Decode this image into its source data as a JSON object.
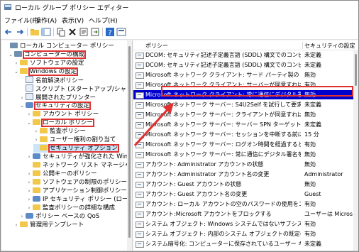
{
  "window": {
    "title": "ローカル グループ ポリシー エディター"
  },
  "menu": [
    "ファイル(F)",
    "操作(A)",
    "表示(V)",
    "ヘルプ(H)"
  ],
  "toolbar": [
    "back-icon",
    "forward-icon",
    "folder-up-icon",
    "console-tree-icon",
    "copy-icon",
    "delete-icon",
    "properties-icon",
    "export-icon",
    "help-icon",
    "view-icon"
  ],
  "tree": {
    "items": [
      {
        "label": "ローカル コンピューター ポリシー",
        "icon": "computer-icon",
        "expander": ""
      },
      {
        "label": "コンピューターの構成",
        "icon": "computer-icon",
        "expander": "⌄"
      },
      {
        "label": "ソフトウェアの設定",
        "icon": "folder-icon",
        "expander": "›"
      },
      {
        "label": "Windows の設定",
        "icon": "folder-icon",
        "expander": "⌄"
      },
      {
        "label": "名前解決ポリシー",
        "icon": "document-icon",
        "expander": ""
      },
      {
        "label": "スクリプト (スタートアップ/シャットダウン)",
        "icon": "document-icon",
        "expander": ""
      },
      {
        "label": "展開されたプリンター",
        "icon": "printer-icon",
        "expander": "›"
      },
      {
        "label": "セキュリティの設定",
        "icon": "shield-icon",
        "expander": "⌄"
      },
      {
        "label": "アカウント ポリシー",
        "icon": "folder-icon",
        "expander": "›"
      },
      {
        "label": "ローカル ポリシー",
        "icon": "folder-icon",
        "expander": "⌄"
      },
      {
        "label": "監査ポリシー",
        "icon": "folder-icon",
        "expander": "›"
      },
      {
        "label": "ユーザー権利の割り当て",
        "icon": "folder-icon",
        "expander": "›"
      },
      {
        "label": "セキュリティ オプション",
        "icon": "folder-icon",
        "expander": ""
      },
      {
        "label": "セキュリティが強化された Windows",
        "icon": "shield-icon",
        "expander": "›"
      },
      {
        "label": "ネットワーク リスト マネージャー ポリ",
        "icon": "folder-icon",
        "expander": ""
      },
      {
        "label": "公開キーのポリシー",
        "icon": "folder-icon",
        "expander": "›"
      },
      {
        "label": "ソフトウェアの制限のポリシー",
        "icon": "folder-icon",
        "expander": "›"
      },
      {
        "label": "アプリケーション制御ポリシー",
        "icon": "folder-icon",
        "expander": "›"
      },
      {
        "label": "IP セキュリティ ポリシー (ローカル",
        "icon": "shield-icon",
        "expander": "›"
      },
      {
        "label": "監査ポリシーの詳細な構成",
        "icon": "folder-icon",
        "expander": "›"
      },
      {
        "label": "ポリシー ベースの QoS",
        "icon": "chart-icon",
        "expander": "›"
      },
      {
        "label": "管理用テンプレート",
        "icon": "folder-icon",
        "expander": "›"
      }
    ]
  },
  "list": {
    "columns": [
      "ポリシー",
      "セキュリティの設定"
    ],
    "rows": [
      {
        "policy": "DCOM: セキュリティ記述子定義言語 (SDDL) 構文でのコンピュータ...",
        "setting": "未定義"
      },
      {
        "policy": "DCOM: セキュリティ記述子定義言語 (SDDL) 構文でのコンピュータ...",
        "setting": "未定義"
      },
      {
        "policy": "Microsoft ネットワーク クライアント: サード パーティ製の SMB サーバ...",
        "setting": "無効"
      },
      {
        "policy": "Microsoft ネットワーク クライアント: サーバーが同意すれば、通信に...",
        "setting": "有効"
      },
      {
        "policy": "Microsoft ネットワーク クライアント: 常に通信にデジタル署名を行う",
        "setting": "無効"
      },
      {
        "policy": "Microsoft ネットワーク サーバー: S4U2Self を試行して要求情報を...",
        "setting": "未定義"
      },
      {
        "policy": "Microsoft ネットワーク サーバー: クライアントが同意すれば、通信に...",
        "setting": "無効"
      },
      {
        "policy": "Microsoft ネットワーク サーバー: サーバー SPN ターゲット名検証レベル",
        "setting": "未定義"
      },
      {
        "policy": "Microsoft ネットワーク サーバー: セッションを中断する前に、必要なア...",
        "setting": "15 分"
      },
      {
        "policy": "Microsoft ネットワーク サーバー: ログオン時間を経過するとクライアン...",
        "setting": "有効"
      },
      {
        "policy": "Microsoft ネットワーク サーバー: 常に通信にデジタル署名を行う",
        "setting": "無効"
      },
      {
        "policy": "アカウント: Administrator アカウントの状態",
        "setting": "無効"
      },
      {
        "policy": "アカウント: Administrator アカウント名の変更",
        "setting": "Administrator"
      },
      {
        "policy": "アカウント: Guest アカウントの状態",
        "setting": "無効"
      },
      {
        "policy": "アカウント: Guest アカウント名の変更",
        "setting": "Guest"
      },
      {
        "policy": "アカウント: ローカル アカウントの空のパスワードの使用をコンソール ログ...",
        "setting": "有効"
      },
      {
        "policy": "アカウント:Microsoft アカウントをブロックする",
        "setting": "ユーザーは Microsof"
      },
      {
        "policy": "システム オブジェクト: Windows システムではないサブシステムのため...",
        "setting": "有効"
      },
      {
        "policy": "システム オブジェクト: 内部のシステム オブジェクトの既定のアクセス許...",
        "setting": "有効"
      },
      {
        "policy": "システム暗号化: コンピューターに保存されているユーザー キーに強力な...",
        "setting": "未定義"
      }
    ],
    "selected_index": 4
  },
  "colors": {
    "highlight": "#e03030",
    "selection": "#0000cc"
  }
}
